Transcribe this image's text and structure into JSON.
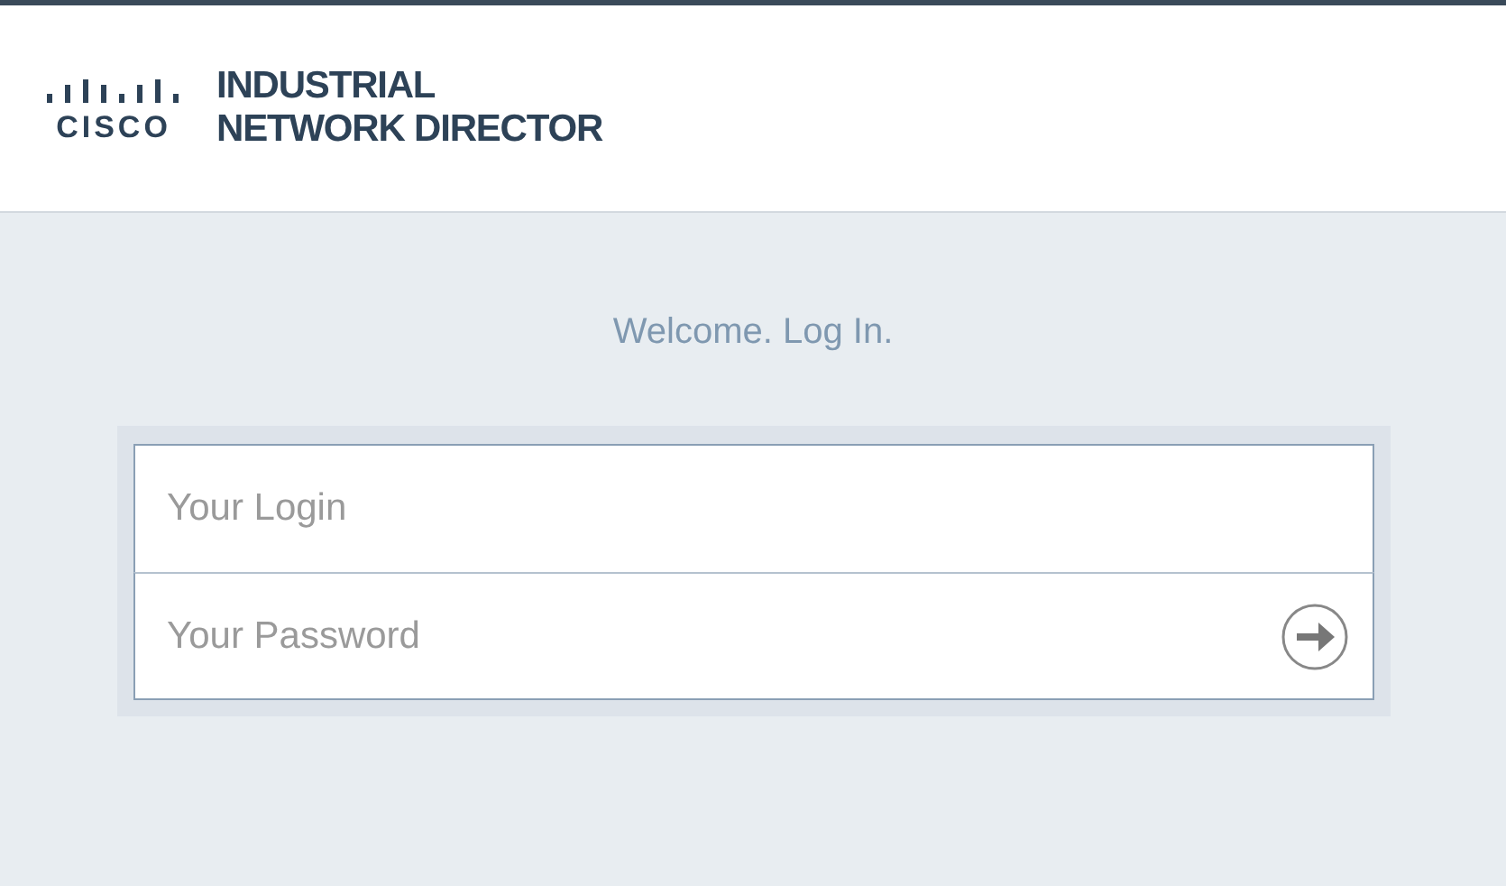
{
  "header": {
    "logo_word": "CISCO",
    "product_lines": [
      "INDUSTRIAL",
      "NETWORK DIRECTOR"
    ]
  },
  "welcome": "Welcome. Log In.",
  "login_form": {
    "fields": [
      {
        "kind": "text",
        "placeholder": "Your Login"
      },
      {
        "kind": "password",
        "placeholder": "Your Password"
      }
    ]
  }
}
